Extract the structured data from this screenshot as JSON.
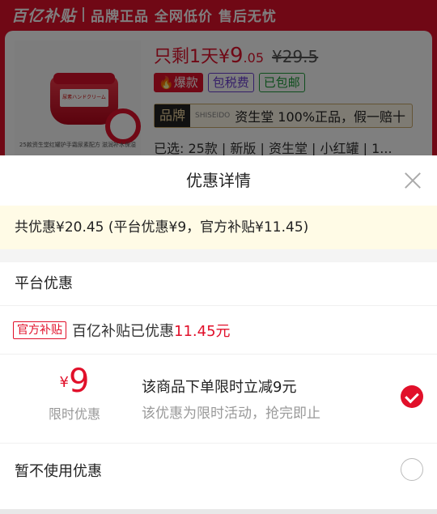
{
  "banner": {
    "logo": "百亿补贴",
    "slogan": "品牌正品 全网低价 售后无忧"
  },
  "product": {
    "image_label": "尿素ハンドクリーム",
    "image_caption": "25款资生堂红罐护手霜尿素配方 滋润补水保湿",
    "price_prefix": "只剩1天¥",
    "price_int": "9",
    "price_dec": ".05",
    "price_original": "¥29.5",
    "tags": [
      "爆款",
      "包税费",
      "已包邮"
    ],
    "brand_label": "品牌",
    "brand_logo": "SHISEIDO",
    "brand_text": "资生堂 100%正品，假一赔十",
    "selected": "已选: 25款 | 新版 | 资生堂 | 小红罐 | 1..."
  },
  "sheet": {
    "title": "优惠详情",
    "summary": "共优惠¥20.45 (平台优惠¥9，官方补贴¥11.45)",
    "platform_section": "平台优惠",
    "subsidy": {
      "badge": "官方补贴",
      "text": "百亿补贴已优惠",
      "amount": "11.45元"
    },
    "coupon": {
      "currency": "¥",
      "amount": "9",
      "type": "限时优惠",
      "description": "该商品下单限时立减9元",
      "note": "该优惠为限时活动，抢完即止",
      "selected": true
    },
    "no_use_label": "暂不使用优惠"
  },
  "colors": {
    "accent": "#e1102a",
    "summary_bg": "#fffbe6"
  }
}
